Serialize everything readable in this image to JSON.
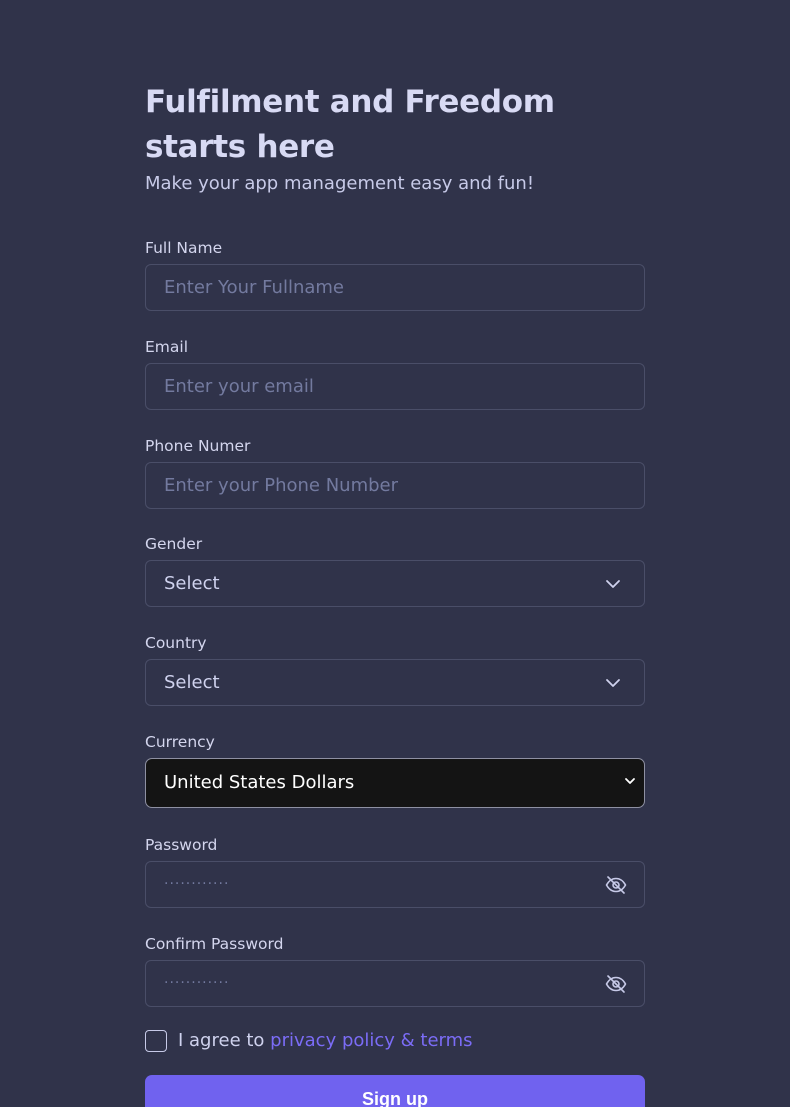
{
  "header": {
    "title": "Fulfilment and Freedom starts here",
    "subtitle": "Make your app management easy and fun!"
  },
  "fields": {
    "full_name": {
      "label": "Full Name",
      "placeholder": "Enter Your Fullname"
    },
    "email": {
      "label": "Email",
      "placeholder": "Enter your email"
    },
    "phone": {
      "label": "Phone Numer",
      "placeholder": "Enter your Phone Number"
    },
    "gender": {
      "label": "Gender",
      "value": "Select"
    },
    "country": {
      "label": "Country",
      "value": "Select"
    },
    "currency": {
      "label": "Currency",
      "value": "United States Dollars"
    },
    "password": {
      "label": "Password",
      "masked": "············"
    },
    "confirm_password": {
      "label": "Confirm Password",
      "masked": "············"
    }
  },
  "agreement": {
    "prefix": "I agree to",
    "link": "privacy policy & terms",
    "checked": false
  },
  "actions": {
    "signup_label": "Sign up"
  },
  "colors": {
    "background": "#30334a",
    "accent": "#7062ef",
    "link": "#7b6cf6"
  }
}
